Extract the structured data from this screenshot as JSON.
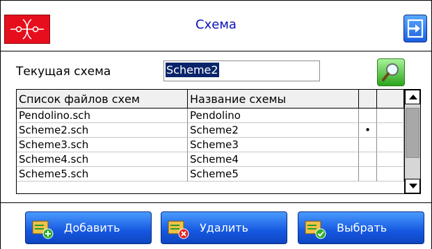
{
  "header": {
    "title": "Схема"
  },
  "current_scheme": {
    "label": "Текущая схема",
    "value": "Scheme2"
  },
  "table": {
    "columns": [
      "Список файлов схем",
      "Название схемы",
      "",
      ""
    ],
    "rows": [
      {
        "file": "Pendolino.sch",
        "name": "Pendolino",
        "mark": ""
      },
      {
        "file": "Scheme2.sch",
        "name": "Scheme2",
        "mark": "•"
      },
      {
        "file": "Scheme3.sch",
        "name": "Scheme3",
        "mark": ""
      },
      {
        "file": "Scheme4.sch",
        "name": "Scheme4",
        "mark": ""
      },
      {
        "file": "Scheme5.sch",
        "name": "Scheme5",
        "mark": ""
      }
    ]
  },
  "buttons": {
    "add": "Добавить",
    "delete": "Удалить",
    "select": "Выбрать"
  },
  "icons": {
    "logo": "rail-logo-icon",
    "exit": "exit-icon",
    "search": "search-icon",
    "add": "add-icon",
    "delete": "delete-icon",
    "select": "select-icon"
  },
  "colors": {
    "title": "#0a10b8",
    "logo_bg": "#e60e1c",
    "button": "#1558e0",
    "search": "#2ba51b",
    "selection": "#0a246a"
  }
}
